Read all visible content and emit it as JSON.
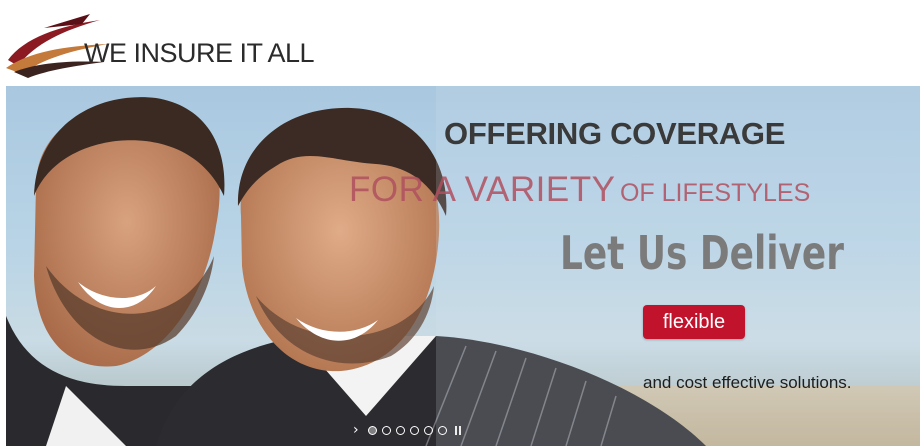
{
  "header": {
    "logo_text": "WE INSURE IT ALL"
  },
  "hero": {
    "headline_1": "OFFERING COVERAGE",
    "headline_2_large": "FOR A VARIETY",
    "headline_2_small": "OF LIFESTYLES",
    "headline_3": "Let Us Deliver",
    "badge_label": "flexible",
    "tagline": "and cost effective solutions.",
    "slider": {
      "next_glyph": "›",
      "dots": [
        "slide-1",
        "slide-2",
        "slide-3",
        "slide-4",
        "slide-5",
        "slide-6"
      ],
      "active_index": 0
    }
  },
  "colors": {
    "brand_red": "#c2132d",
    "headline_pink": "#b0505f",
    "sky": "#a9c8e0"
  },
  "icons": [
    "logo-swoosh-icon",
    "next-arrow-icon",
    "pause-icon"
  ]
}
